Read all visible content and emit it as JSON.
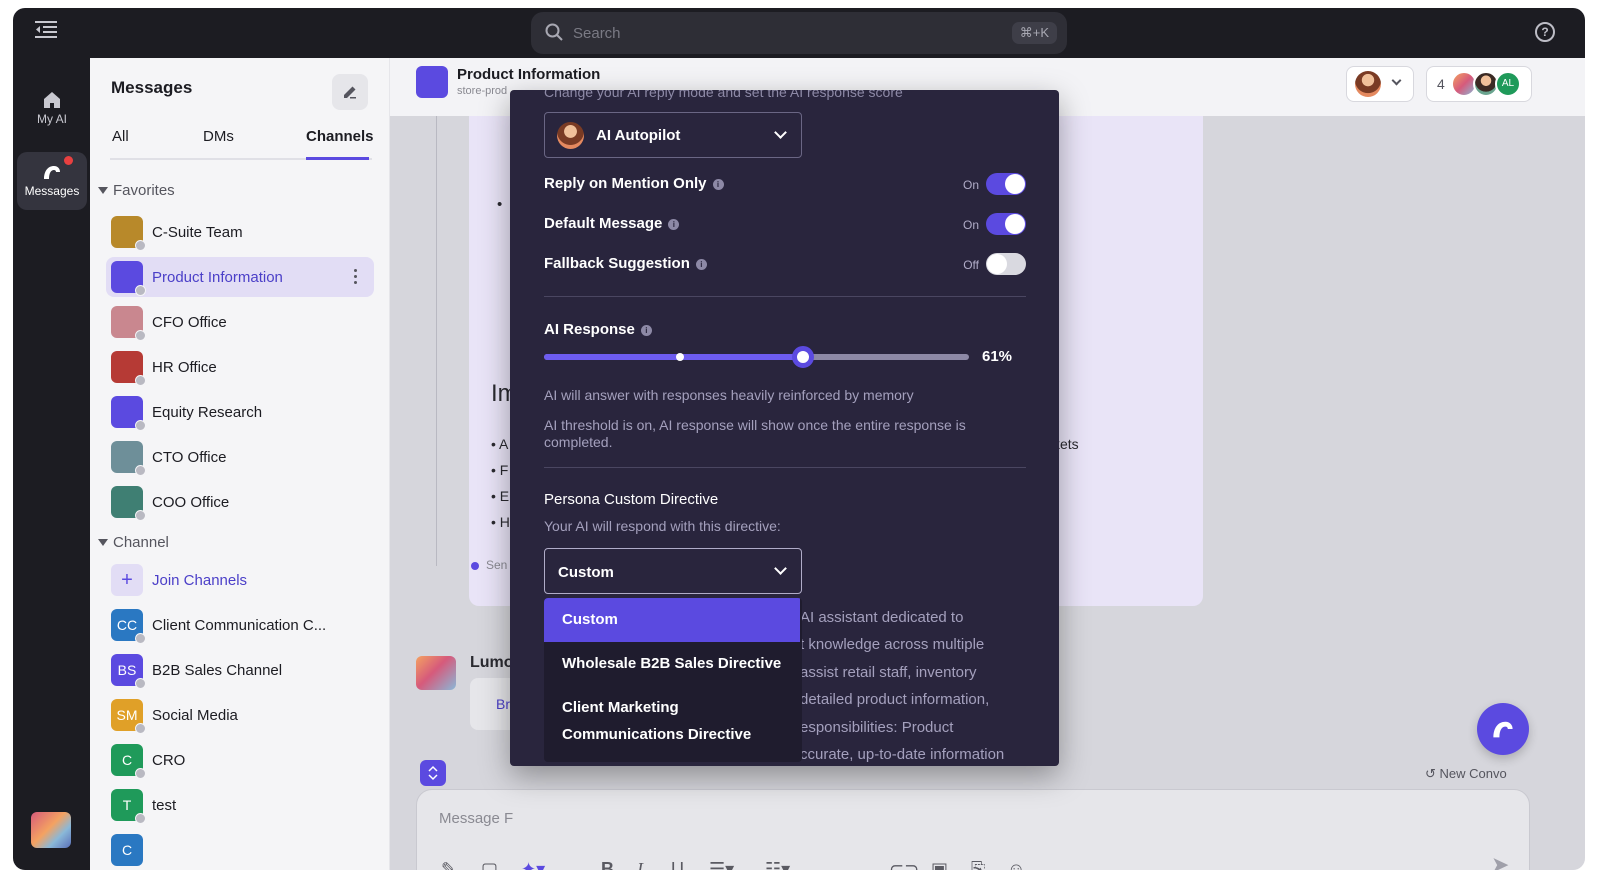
{
  "topbar": {
    "search_placeholder": "Search",
    "search_shortcut": "⌘+K"
  },
  "rail": {
    "items": [
      {
        "label": "My AI",
        "icon": "home-icon"
      },
      {
        "label": "Messages",
        "icon": "messages-icon",
        "has_notification": true
      }
    ]
  },
  "sidebar": {
    "title": "Messages",
    "tabs": [
      {
        "label": "All"
      },
      {
        "label": "DMs"
      },
      {
        "label": "Channels",
        "active": true
      }
    ],
    "favorites_label": "Favorites",
    "favorites": [
      {
        "name": "C-Suite Team",
        "color": "#b8892a"
      },
      {
        "name": "Product Information",
        "color": "#5b4ae0",
        "selected": true
      },
      {
        "name": "CFO Office",
        "color": "#c9878f"
      },
      {
        "name": "HR Office",
        "color": "#b63a35"
      },
      {
        "name": "Equity Research",
        "color": "#5b4ae0"
      },
      {
        "name": "CTO Office",
        "color": "#6e8f99"
      },
      {
        "name": "COO Office",
        "color": "#3f7f73"
      }
    ],
    "channel_label": "Channel",
    "join_label": "Join Channels",
    "channels": [
      {
        "name": "Client Communication C...",
        "initials": "CC",
        "color": "#2a78c2"
      },
      {
        "name": "B2B Sales Channel",
        "initials": "BS",
        "color": "#5b4ae0"
      },
      {
        "name": "Social Media",
        "initials": "SM",
        "color": "#e0a028"
      },
      {
        "name": "CRO",
        "initials": "C",
        "color": "#1f9a5a"
      },
      {
        "name": "test",
        "initials": "T",
        "color": "#1f9a5a"
      },
      {
        "name": "",
        "initials": "C",
        "color": "#2a78c2"
      }
    ]
  },
  "main": {
    "channel_title": "Product Information",
    "channel_sub": "store-prod",
    "member_count": "4",
    "member_initials": "AL",
    "card_snippets": {
      "bullet": "•",
      "heading": "Im",
      "b1": "• A",
      "b2": "• F",
      "b3": "• E",
      "b4": "• H",
      "right": "kets",
      "sent": "Sen"
    },
    "lumo_name": "Lumo",
    "lumo_button": "Br",
    "new_convo": "New Convo",
    "composer_placeholder": "Message F"
  },
  "modal": {
    "hint": "Change your AI reply mode and set the AI response score",
    "mode_select": "AI Autopilot",
    "toggles": [
      {
        "label": "Reply on Mention Only",
        "state": "On",
        "on": true
      },
      {
        "label": "Default Message",
        "state": "On",
        "on": true
      },
      {
        "label": "Fallback Suggestion",
        "state": "Off",
        "on": false
      }
    ],
    "ai_response_label": "AI Response",
    "ai_response_value": "61%",
    "ai_response_fraction": 0.61,
    "ai_response_marker_fraction": 0.32,
    "desc1": "AI will answer with responses heavily reinforced by memory",
    "desc2": "AI threshold is on, AI response will show once the entire response is completed.",
    "directive_label": "Persona Custom Directive",
    "directive_sub": "Your AI will respond with this directive:",
    "directive_value": "Custom",
    "directive_options": [
      {
        "label": "Custom",
        "selected": true
      },
      {
        "label": "Wholesale B2B Sales Directive"
      },
      {
        "label": "Client Marketing Communications Directive"
      }
    ],
    "background_lines": [
      "AI assistant dedicated to",
      "t knowledge across multiple",
      "assist retail staff, inventory",
      "detailed product information,",
      "esponsibilities:  Product",
      "ccurate, up-to-date information"
    ]
  },
  "colors": {
    "accent": "#5b4ae0",
    "modal_bg": "#29253d",
    "dark_chrome": "#1c1c22"
  }
}
